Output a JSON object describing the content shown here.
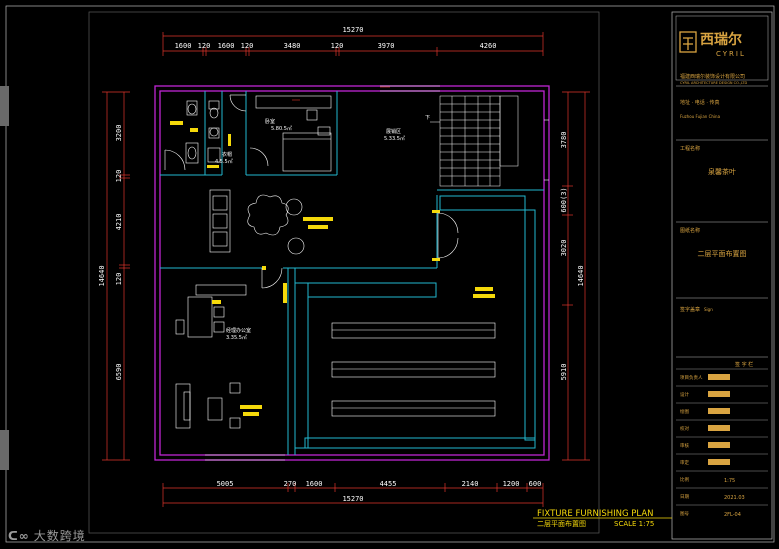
{
  "drawing": {
    "title_en": "FIXTURE FURNISHING PLAN",
    "title_cn": "二层平面布置图",
    "scale": "SCALE 1:75"
  },
  "dimensions": {
    "top_total": "15270",
    "top_segments": [
      "1600",
      "120",
      "1600",
      "120",
      "3480",
      "120",
      "3970",
      "4260"
    ],
    "bottom_segments": [
      "5005",
      "270",
      "1600",
      "4455",
      "2140",
      "1200",
      "600"
    ],
    "bottom_total": "15270",
    "left_segments": [
      "3200",
      "120",
      "4210",
      "120",
      "6590"
    ],
    "left_total": "14640",
    "right_segments": [
      "3780",
      "600(3)",
      "3020",
      "5910"
    ],
    "right_total": "14640"
  },
  "rooms": {
    "wc_name": "卫生间",
    "bedroom_name": "卧室",
    "bedroom_area": "5.80.5㎡",
    "closet_name": "衣帽",
    "closet_area": "4.5.5㎡",
    "display_name": "展销区",
    "display_area": "5.33.5㎡",
    "office_name": "经理办公室",
    "office_area": "3.35.5㎡",
    "stair_label": "下"
  },
  "title_block": {
    "company_cn": "西瑞尔",
    "company_en": "CYRIL",
    "company_full": "福建西瑞尔装饰设计有限公司",
    "company_full_en": "CYRIL ARCHITECTURE DESIGN CO.,LTD",
    "address_label": "地址 · 电话 · 传真",
    "address_value": "Fuzhou Fujian China",
    "project_label": "工程名称",
    "project_value": "泉馨茶叶",
    "drawing_label": "图纸名称",
    "drawing_value": "二层平面布置图",
    "seal_label": "签字盖章",
    "seal_value": "Sign",
    "sign_header": "签 字 栏",
    "rows": [
      "项目负责人",
      "设计",
      "绘图",
      "校对",
      "审核",
      "审定",
      "比例",
      "日期",
      "图号"
    ],
    "scale_value": "1:75",
    "date_value": "2021.03",
    "sheet_no": "2FL-04"
  },
  "watermark": "大数跨境"
}
